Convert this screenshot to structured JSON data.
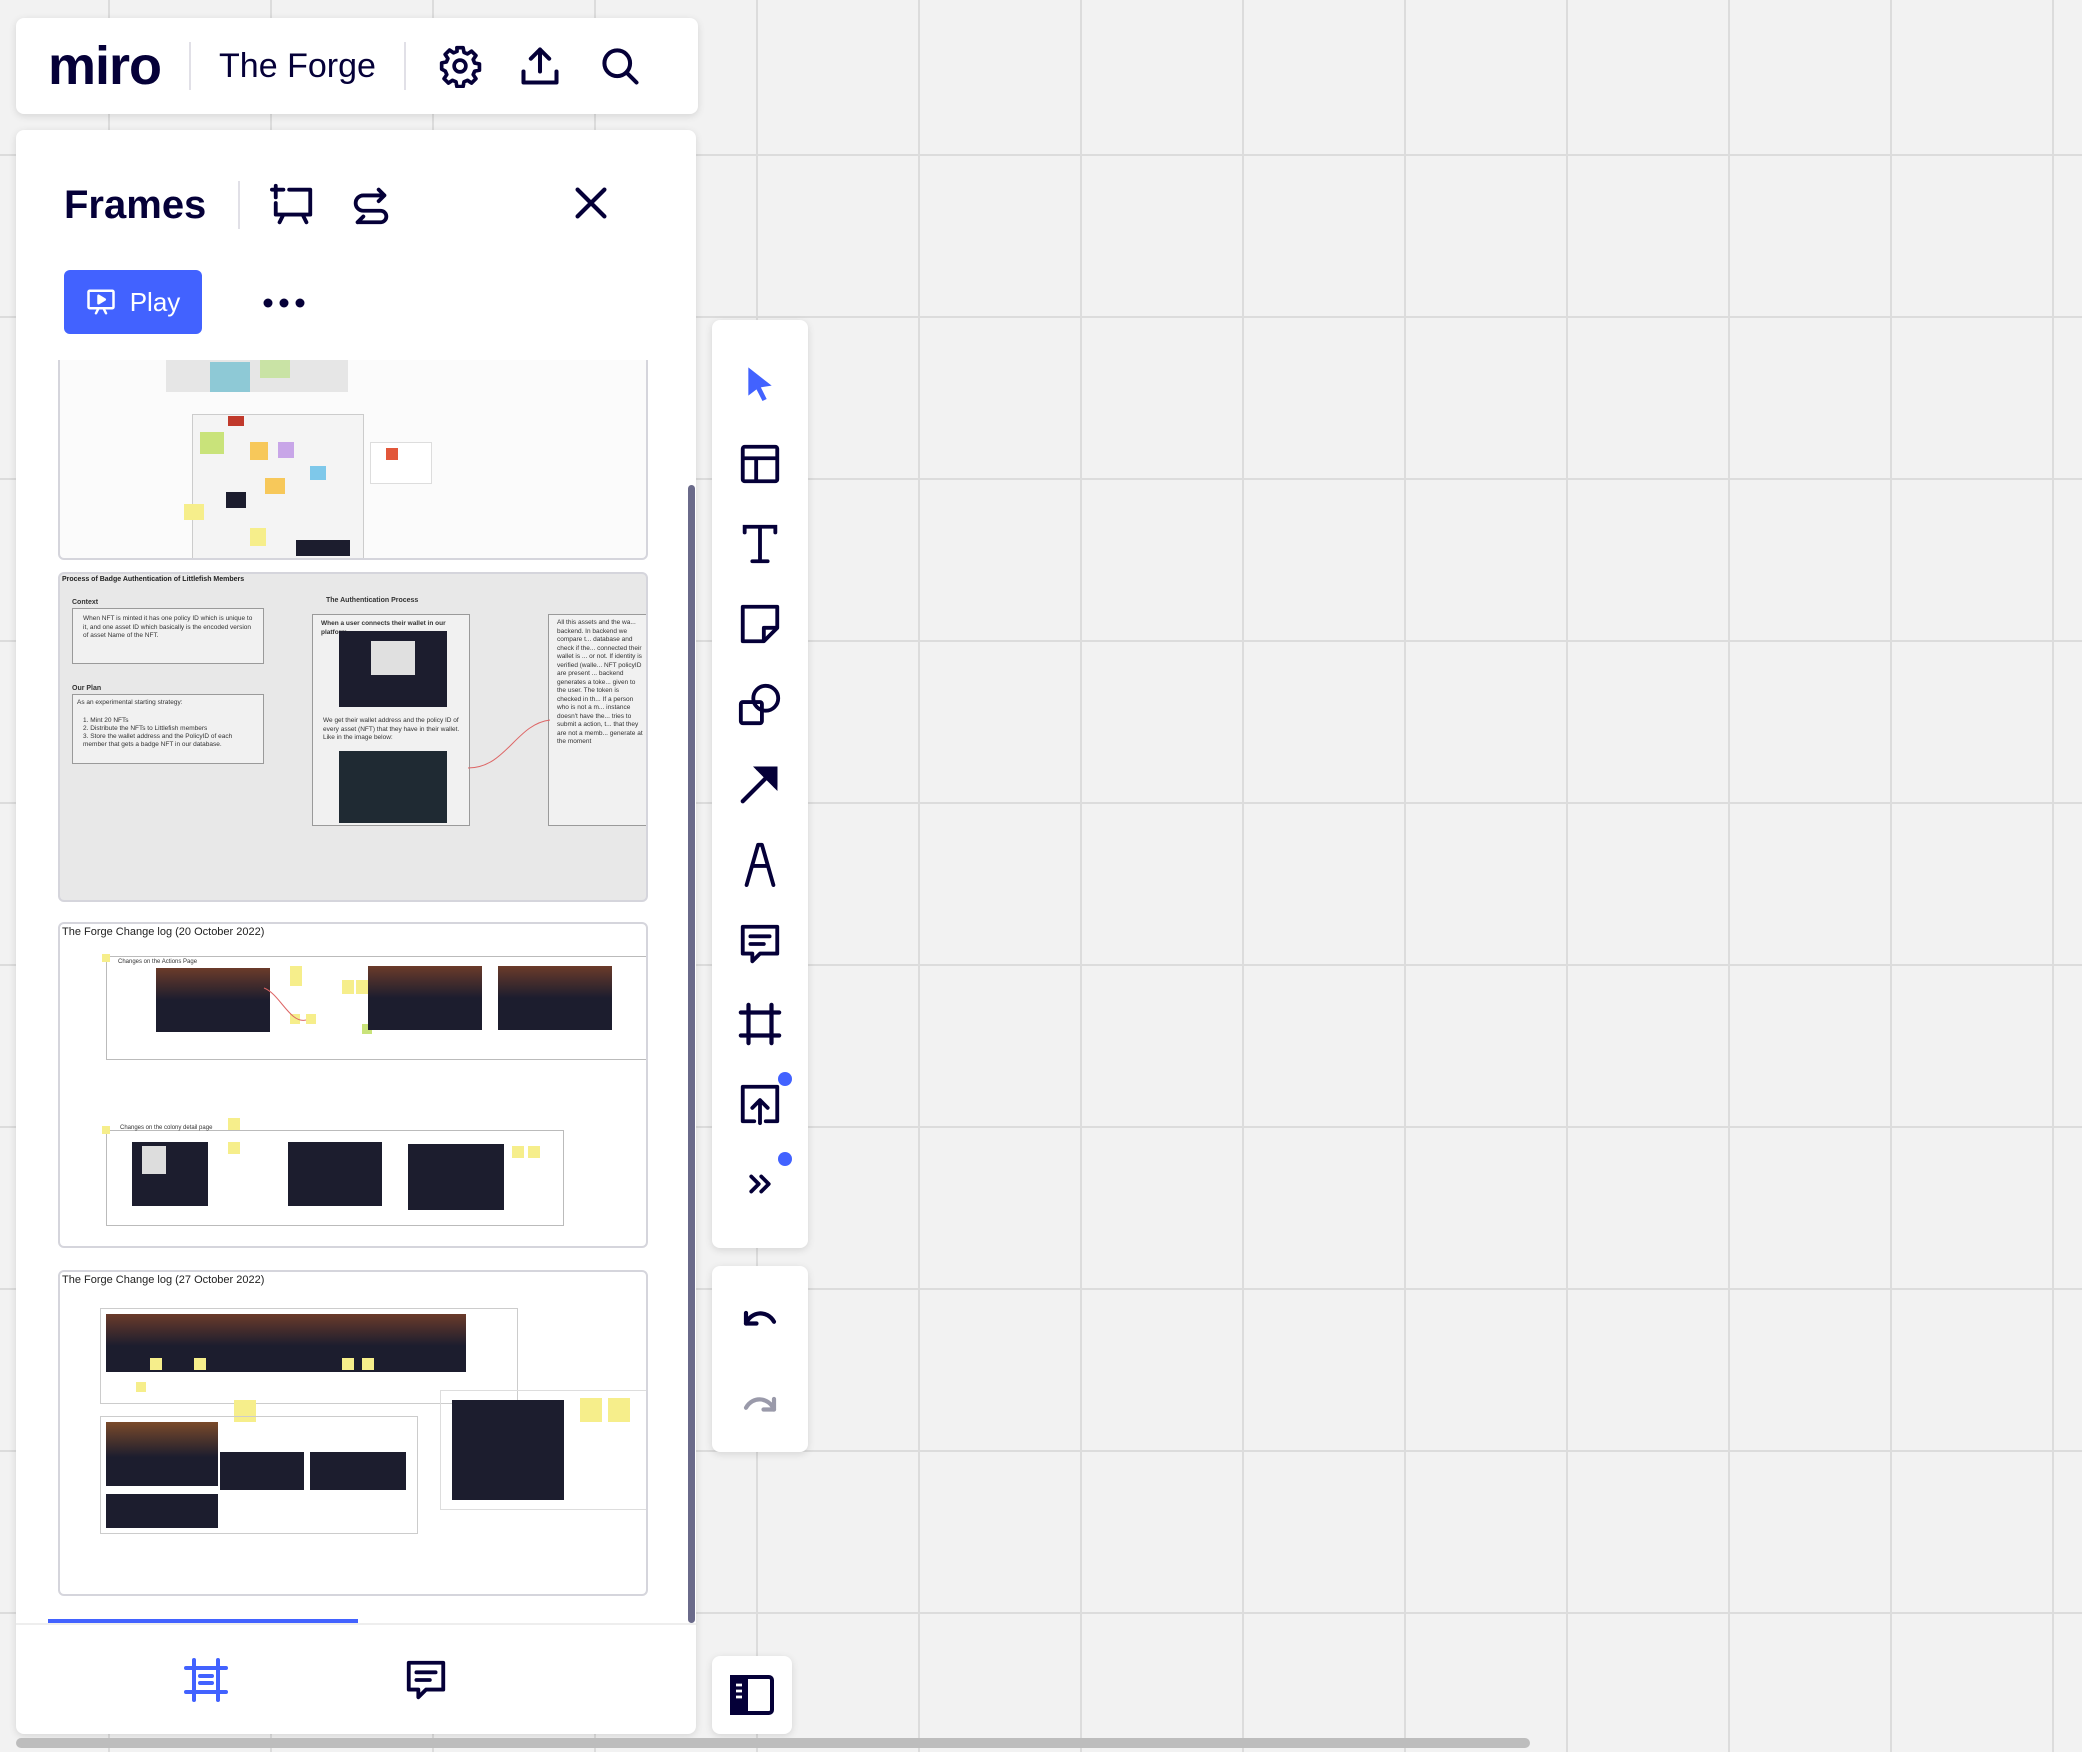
{
  "app": {
    "logo": "miro",
    "board_title": "The Forge",
    "icons": [
      "gear-icon",
      "upload-icon",
      "search-icon"
    ]
  },
  "frames_panel": {
    "title": "Frames",
    "play_label": "Play",
    "header_icons": [
      "add-frame-icon",
      "reorder-icon",
      "close-icon"
    ],
    "frames": [
      {
        "title": ""
      },
      {
        "title": "Process of Badge Authentication of Littlefish Members",
        "context_heading": "Context",
        "context_text": "When NFT is minted it has one policy ID which is unique to it, and one asset ID which basically is the encoded version of asset Name of the NFT.",
        "plan_heading": "Our Plan",
        "plan_intro": "As an experimental starting strategy:",
        "plan_items": [
          "1. Mint 20 NFTs",
          "2. Distribute the NFTs to Littlefish members",
          "3. Store the wallet address and the PolicyID of each member that gets a badge NFT in our database."
        ],
        "process_heading": "The Authentication Process",
        "process_sub": "When a user connects their wallet in our platform",
        "process_text": "We get their wallet address and the policy ID of every asset (NFT) that they have in their wallet. Like in the image below:",
        "side_text": "All this assets and the wa... backend. In backend we compare t... database and check if the... connected their wallet is ... or not. If identity is verified (walle... NFT policyID are present ... backend generates a toke... given to the user. The token is checked in th... If a person who is not a m... instance doesn't have the... tries to submit a action, t... that they are not a memb... generate at the moment"
      },
      {
        "title": "The Forge Change log (20 October 2022)",
        "section1": "Changes on the Actions Page",
        "section2": "Changes on the colony detail page"
      },
      {
        "title": "The Forge Change log (27 October 2022)"
      }
    ],
    "tabs": [
      "frames-tab",
      "comments-tab"
    ],
    "active_tab": "frames-tab"
  },
  "toolbar": {
    "tools": [
      "select",
      "templates",
      "text",
      "sticky-note",
      "shapes",
      "connection-line",
      "pen",
      "comment",
      "frame",
      "upload",
      "more-tools"
    ],
    "active_tool": "select",
    "notification_dots": [
      "upload",
      "more-tools"
    ],
    "undo": "undo",
    "redo": "redo"
  },
  "colors": {
    "accent": "#4262ff",
    "ink": "#050038",
    "canvas": "#f2f2f2",
    "grid": "#dcdcdc"
  }
}
